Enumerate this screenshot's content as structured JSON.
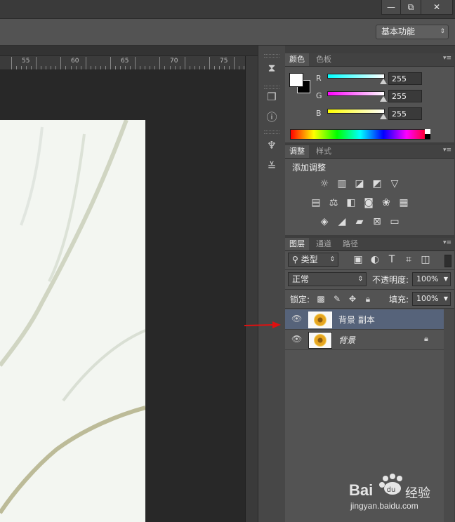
{
  "window": {
    "minimize_icon": "minimize-icon",
    "restore_icon": "restore-icon",
    "close_icon": "close-icon",
    "minimize_glyph": "—",
    "restore_glyph": "⧉",
    "close_glyph": "✕"
  },
  "options_bar": {
    "workspace": "基本功能"
  },
  "ruler": {
    "labels": [
      "55",
      "60",
      "65",
      "70",
      "75"
    ]
  },
  "color_panel": {
    "tabs": [
      "颜色",
      "色板"
    ],
    "channels": [
      {
        "label": "R",
        "value": "255"
      },
      {
        "label": "G",
        "value": "255"
      },
      {
        "label": "B",
        "value": "255"
      }
    ],
    "foreground": "#ffffff",
    "background": "#000000"
  },
  "adjustments_panel": {
    "tabs": [
      "调整",
      "样式"
    ],
    "title": "添加调整"
  },
  "layers_panel": {
    "tabs": [
      "图层",
      "通道",
      "路径"
    ],
    "filter_label": "类型",
    "blend_mode": "正常",
    "opacity_label": "不透明度:",
    "opacity_value": "100%",
    "lock_label": "锁定:",
    "fill_label": "填充:",
    "fill_value": "100%",
    "layers": [
      {
        "name": "背景 副本",
        "selected": true
      },
      {
        "name": "背景",
        "selected": false,
        "locked": true
      }
    ]
  },
  "watermark": {
    "brand": "Bai",
    "brand2": "经验",
    "url": "jingyan.baidu.com"
  },
  "colors": {
    "selection": "#56637a",
    "annotation_arrow": "#e01010"
  }
}
